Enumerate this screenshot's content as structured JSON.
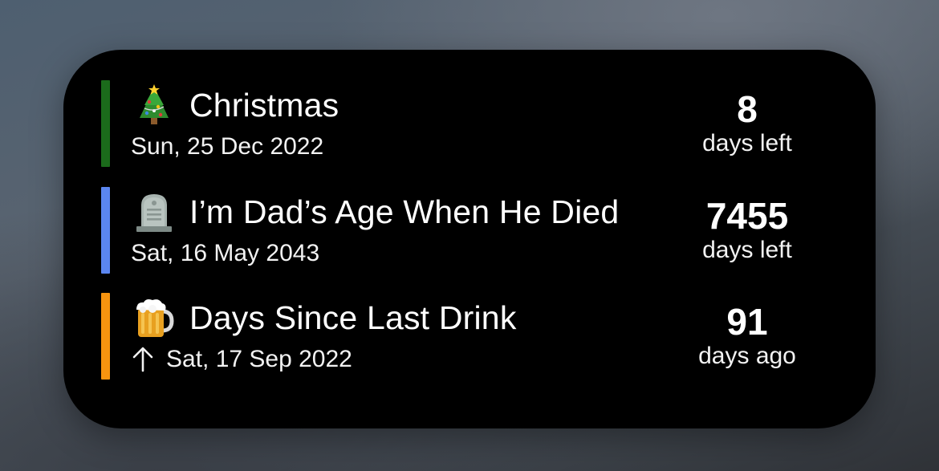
{
  "widget": {
    "events": [
      {
        "icon": "christmas-tree-icon",
        "title": "Christmas",
        "date": "Sun, 25 Dec 2022",
        "count": "8",
        "unit": "days left",
        "accent_color": "#1b6b1b",
        "count_up": false
      },
      {
        "icon": "headstone-icon",
        "title": "I’m Dad’s Age When He Died",
        "date": "Sat, 16 May 2043",
        "count": "7455",
        "unit": "days left",
        "accent_color": "#5b86f0",
        "count_up": false
      },
      {
        "icon": "beer-mug-icon",
        "title": "Days Since Last Drink",
        "date": "Sat, 17 Sep 2022",
        "count": "91",
        "unit": "days ago",
        "accent_color": "#f7940f",
        "count_up": true
      }
    ]
  }
}
